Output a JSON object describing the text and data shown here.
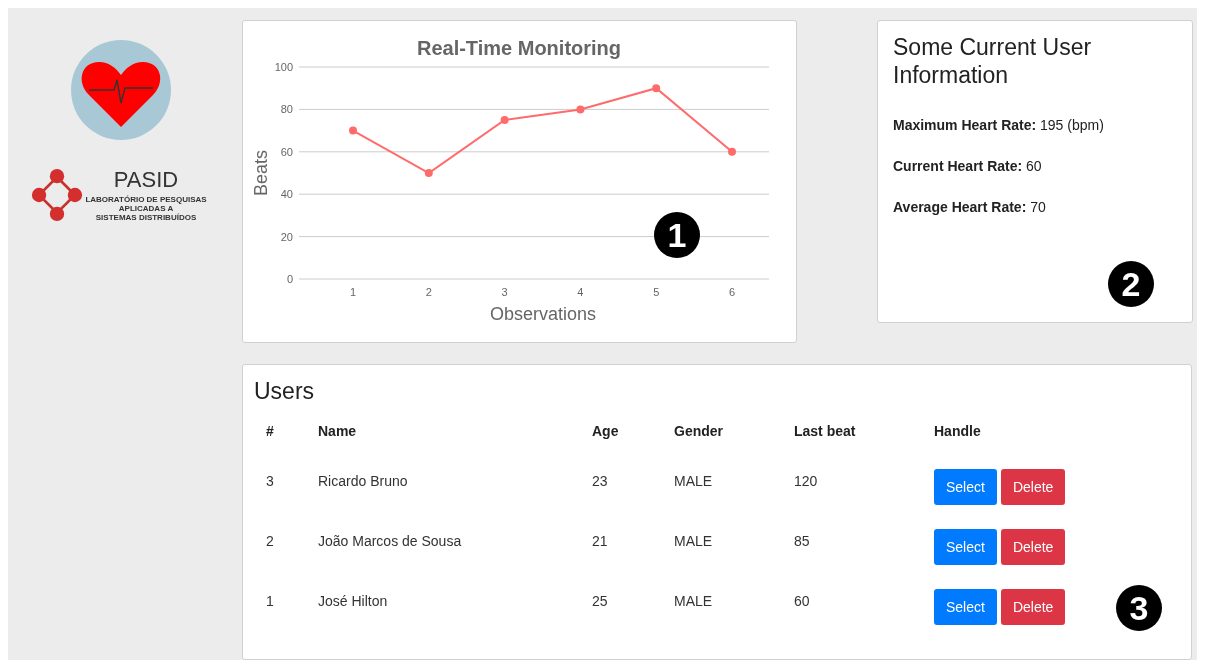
{
  "logo": {
    "name": "PASID",
    "subtitle_lines": [
      "LABORATÓRIO DE PESQUISAS",
      "APLICADAS A",
      "SISTEMAS DISTRIBUÍDOS"
    ]
  },
  "chart_card": {
    "callout": "1",
    "chart_data": {
      "type": "line",
      "title": "Real-Time Monitoring",
      "xlabel": "Observations",
      "ylabel": "Beats",
      "categories": [
        "1",
        "2",
        "3",
        "4",
        "5",
        "6"
      ],
      "series": [
        {
          "color": "#ff6b6b",
          "marker": true,
          "values": [
            70,
            50,
            75,
            80,
            90,
            60
          ]
        }
      ],
      "grid": true,
      "ylim": [
        0,
        100
      ],
      "yticks": [
        0,
        20,
        40,
        60,
        80,
        100
      ]
    }
  },
  "info_card": {
    "title": "Some Current User Information",
    "lines": [
      "**Maximum Heart Rate:** 195 (bpm)",
      "**Current Heart Rate:** 60",
      "**Average Heart Rate:** 70"
    ],
    "callout": "2"
  },
  "users": {
    "title": "Users",
    "columns": [
      "#",
      "Name",
      "Age",
      "Gender",
      "Last beat",
      "Handle"
    ],
    "rows": [
      {
        "cells": [
          "3",
          "Ricardo Bruno",
          "23",
          "MALE",
          "120"
        ],
        "actions": [
          "Select",
          "Delete"
        ]
      },
      {
        "cells": [
          "2",
          "João Marcos de Sousa",
          "21",
          "MALE",
          "85"
        ],
        "actions": [
          "Select",
          "Delete"
        ]
      },
      {
        "cells": [
          "1",
          "José Hilton",
          "25",
          "MALE",
          "60"
        ],
        "actions": [
          "Select",
          "Delete"
        ]
      }
    ],
    "callout": "3"
  }
}
